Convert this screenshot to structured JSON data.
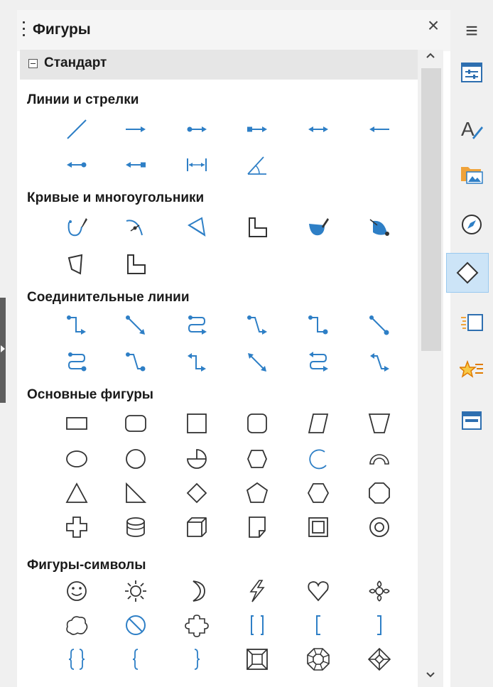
{
  "panel": {
    "title": "Фигуры",
    "close_label": "×",
    "menu_label": "≡"
  },
  "palette": {
    "name": "Стандарт"
  },
  "sections": [
    {
      "title": "Линии и стрелки",
      "shapes": [
        "line",
        "line-ends-arrow",
        "line-starts-circle-ends-arrow",
        "line-starts-square-ends-arrow",
        "line-ends-arrows",
        "line-starts-arrow",
        "line-starts-arrow-ends-circle",
        "line-starts-arrow-ends-square",
        "dimension-line",
        "angle-dimension"
      ]
    },
    {
      "title": "Кривые и многоугольники",
      "shapes": [
        "freeform-line",
        "curve",
        "polygon",
        "polygon-45",
        "freeform-line-filled",
        "curve-filled",
        "polygon-filled",
        "polygon-45-filled"
      ]
    },
    {
      "title": "Соединительные линии",
      "shapes": [
        "connector-ends-arrow",
        "straight-connector-ends-arrow",
        "curved-connector-ends-arrow",
        "line-connector-ends-arrow",
        "connector-ends-circle",
        "straight-connector-ends-circle",
        "curved-connector-ends-circle",
        "line-connector-ends-circle",
        "connector-arrows",
        "straight-connector-arrows",
        "curved-connector-arrows",
        "line-connector-arrows"
      ]
    },
    {
      "title": "Основные фигуры",
      "shapes": [
        "rectangle",
        "rectangle-rounded",
        "square",
        "square-rounded",
        "parallelogram",
        "trapezoid",
        "ellipse",
        "circle",
        "circle-pie",
        "block-arc-circle",
        "arc",
        "block-arc",
        "isosceles-triangle",
        "right-triangle",
        "diamond",
        "pentagon",
        "hexagon",
        "octagon",
        "cross",
        "can",
        "cube",
        "folded-corner",
        "frame",
        "ring"
      ]
    },
    {
      "title": "Фигуры-символы",
      "shapes": [
        "smiley",
        "sun",
        "moon",
        "lightning",
        "heart",
        "flower",
        "cloud",
        "forbidden",
        "puzzle",
        "bracket-pair",
        "left-bracket",
        "right-bracket",
        "brace-pair",
        "left-brace",
        "right-brace",
        "quad-bevel",
        "octagon-bevel",
        "diamond-bevel"
      ]
    }
  ],
  "sidebar_tabs": [
    "properties-icon",
    "styles-icon",
    "gallery-icon",
    "navigator-icon",
    "shapes-icon",
    "page-icon",
    "animation-icon",
    "slide-transition-icon"
  ],
  "colors": {
    "accent": "#2e7fc6",
    "line": "#333333",
    "selected_tab": "#cce4f7"
  }
}
